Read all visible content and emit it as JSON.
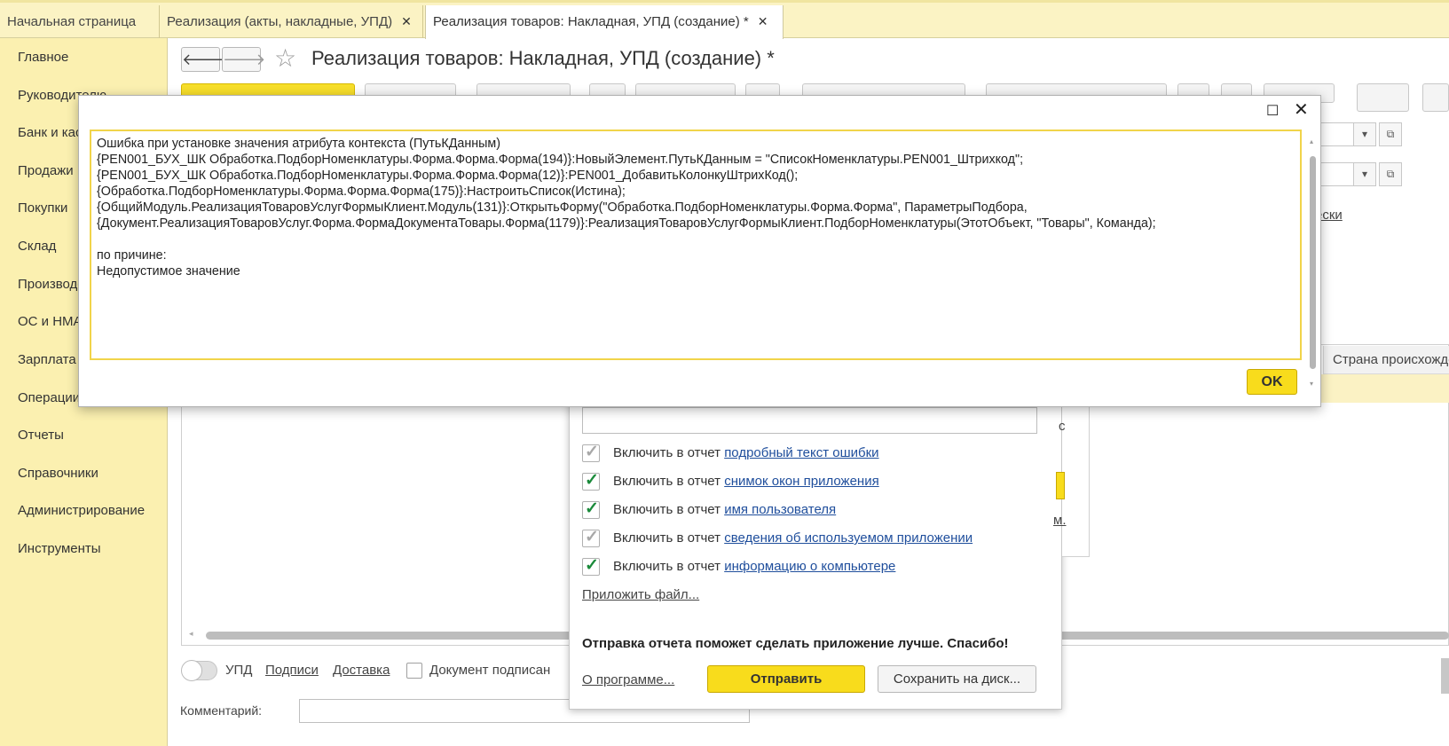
{
  "tabs": [
    {
      "label": "Начальная страница",
      "closable": false,
      "active": false
    },
    {
      "label": "Реализация (акты, накладные, УПД)",
      "closable": true,
      "active": false
    },
    {
      "label": "Реализация товаров: Накладная, УПД (создание) *",
      "closable": true,
      "active": true
    }
  ],
  "tab_close_glyph": "✕",
  "sidebar": {
    "items": [
      {
        "label": "Главное",
        "icon": "menu-icon"
      },
      {
        "label": "Руководителю",
        "icon": "menu-icon"
      },
      {
        "label": "Банк и касса",
        "icon": "menu-icon"
      },
      {
        "label": "Продажи",
        "icon": "menu-icon"
      },
      {
        "label": "Покупки",
        "icon": "menu-icon"
      },
      {
        "label": "Склад",
        "icon": "menu-icon"
      },
      {
        "label": "Производство",
        "icon": "menu-icon"
      },
      {
        "label": "ОС и НМА",
        "icon": "menu-icon"
      },
      {
        "label": "Зарплата и кадры",
        "icon": "menu-icon"
      },
      {
        "label": "Операции",
        "icon": "menu-icon"
      },
      {
        "label": "Отчеты",
        "icon": "menu-icon"
      },
      {
        "label": "Справочники",
        "icon": "menu-icon"
      },
      {
        "label": "Администрирование",
        "icon": "menu-icon"
      },
      {
        "label": "Инструменты",
        "icon": "menu-icon"
      }
    ]
  },
  "document": {
    "title": "Реализация товаров: Накладная, УПД (создание) *",
    "back_glyph": "🡐",
    "forward_glyph": "🡒",
    "star_glyph": "☆",
    "partial_link": "ески",
    "grid_column_right": "Страна происхождения"
  },
  "bottom": {
    "upd_label": "УПД",
    "signatures_link": "Подписи",
    "delivery_link": "Доставка",
    "signed_label": "Документ подписан",
    "comment_label": "Комментарий:"
  },
  "report_dialog": {
    "options": [
      {
        "prefix": "Включить в отчет",
        "link": "подробный текст ошибки",
        "checked": true,
        "disabled": true
      },
      {
        "prefix": "Включить в отчет",
        "link": "снимок окон приложения",
        "checked": true,
        "disabled": false
      },
      {
        "prefix": "Включить в отчет",
        "link": "имя пользователя",
        "checked": true,
        "disabled": false
      },
      {
        "prefix": "Включить в отчет",
        "link": "сведения об используемом приложении",
        "checked": true,
        "disabled": true
      },
      {
        "prefix": "Включить в отчет",
        "link": "информацию о компьютере",
        "checked": true,
        "disabled": false
      }
    ],
    "attach_link": "Приложить файл...",
    "thanks": "Отправка отчета поможет сделать приложение лучше. Спасибо!",
    "about_link": "О программе...",
    "send_label": "Отправить",
    "save_label": "Сохранить на диск...",
    "side_letter": "с",
    "side_link": "м."
  },
  "error_dialog": {
    "text": "Ошибка при установке значения атрибута контекста (ПутьКДанным)\n{PEN001_БУХ_ШК Обработка.ПодборНоменклатуры.Форма.Форма.Форма(194)}:НовыйЭлемент.ПутьКДанным = \"СписокНоменклатуры.PEN001_Штрихкод\";\n{PEN001_БУХ_ШК Обработка.ПодборНоменклатуры.Форма.Форма.Форма(12)}:PEN001_ДобавитьКолонкуШтрихКод();\n{Обработка.ПодборНоменклатуры.Форма.Форма.Форма(175)}:НастроитьСписок(Истина);\n{ОбщийМодуль.РеализацияТоваровУслугФормыКлиент.Модуль(131)}:ОткрытьФорму(\"Обработка.ПодборНоменклатуры.Форма.Форма\", ПараметрыПодбора,\n{Документ.РеализацияТоваровУслуг.Форма.ФормаДокументаТовары.Форма(1179)}:РеализацияТоваровУслугФормыКлиент.ПодборНоменклатуры(ЭтотОбъект, \"Товары\", Команда);\n\nпо причине:\nНедопустимое значение",
    "ok_label": "OK",
    "maximize_glyph": "☐",
    "close_glyph": "✕"
  },
  "colors": {
    "accent_yellow": "#f8dc1c",
    "sidebar_bg": "#fbf0b0",
    "link": "#1f4e9c",
    "check_green": "#1a8a3a"
  }
}
